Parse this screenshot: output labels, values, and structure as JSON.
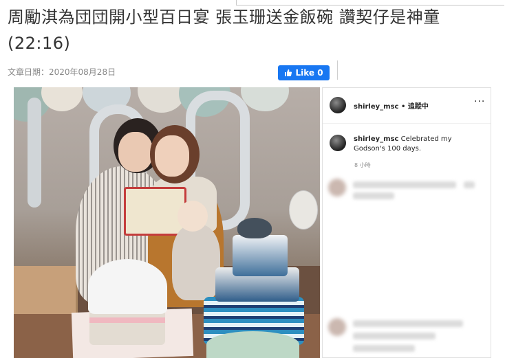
{
  "article": {
    "title": "周勵淇為団団開小型百日宴 張玉珊送金飯碗 讚契仔是神童 (22:16)",
    "date_label": "文章日期：2020年08月28日"
  },
  "like_button": {
    "label": "Like 0",
    "icon": "thumbs-up-icon"
  },
  "instagram": {
    "header_username": "shirley_msc",
    "header_separator": "•",
    "follow_label": "追蹤中",
    "more_label": "···",
    "comment": {
      "username": "shirley_msc",
      "text": "Celebrated my Godson's 100 days.",
      "time": "8 小時"
    }
  },
  "colors": {
    "like_blue": "#1877f2",
    "title_text": "#333333",
    "meta_text": "#888888"
  }
}
